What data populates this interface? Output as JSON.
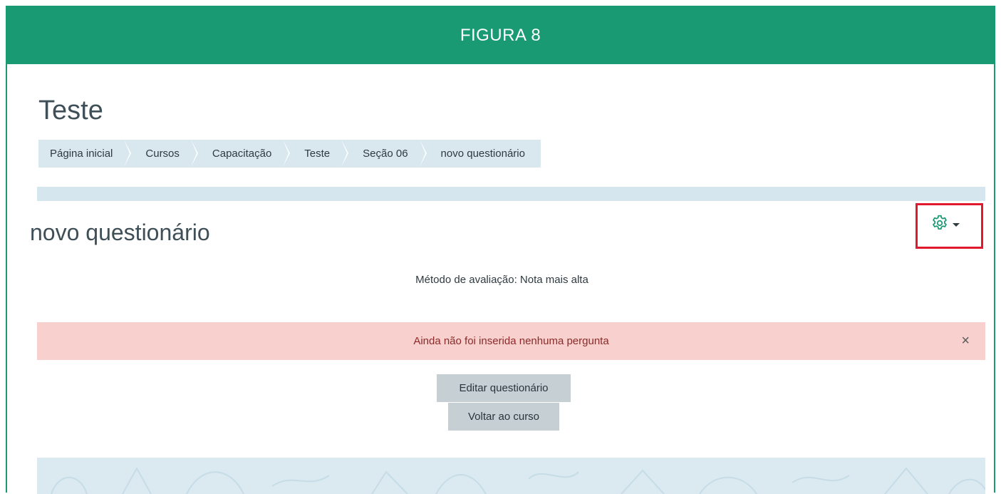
{
  "figure": {
    "label": "FIGURA 8"
  },
  "course": {
    "title": "Teste"
  },
  "breadcrumb": [
    {
      "label": "Página inicial"
    },
    {
      "label": "Cursos"
    },
    {
      "label": "Capacitação"
    },
    {
      "label": "Teste"
    },
    {
      "label": "Seção 06"
    },
    {
      "label": "novo questionário"
    }
  ],
  "quiz": {
    "title": "novo questionário",
    "grading_method": "Método de avaliação: Nota mais alta",
    "alert": "Ainda não foi inserida nenhuma pergunta",
    "alert_close": "×",
    "edit_button": "Editar questionário",
    "back_button": "Voltar ao curso"
  },
  "icons": {
    "settings": "gear-icon",
    "dropdown": "caret-down-icon",
    "close": "close-icon"
  },
  "colors": {
    "header": "#1a9a72",
    "highlight": "#e0192d",
    "alert_bg": "#f8d0cd",
    "button_bg": "#c6cfd4",
    "breadcrumb_bg": "#d9e8ef"
  }
}
